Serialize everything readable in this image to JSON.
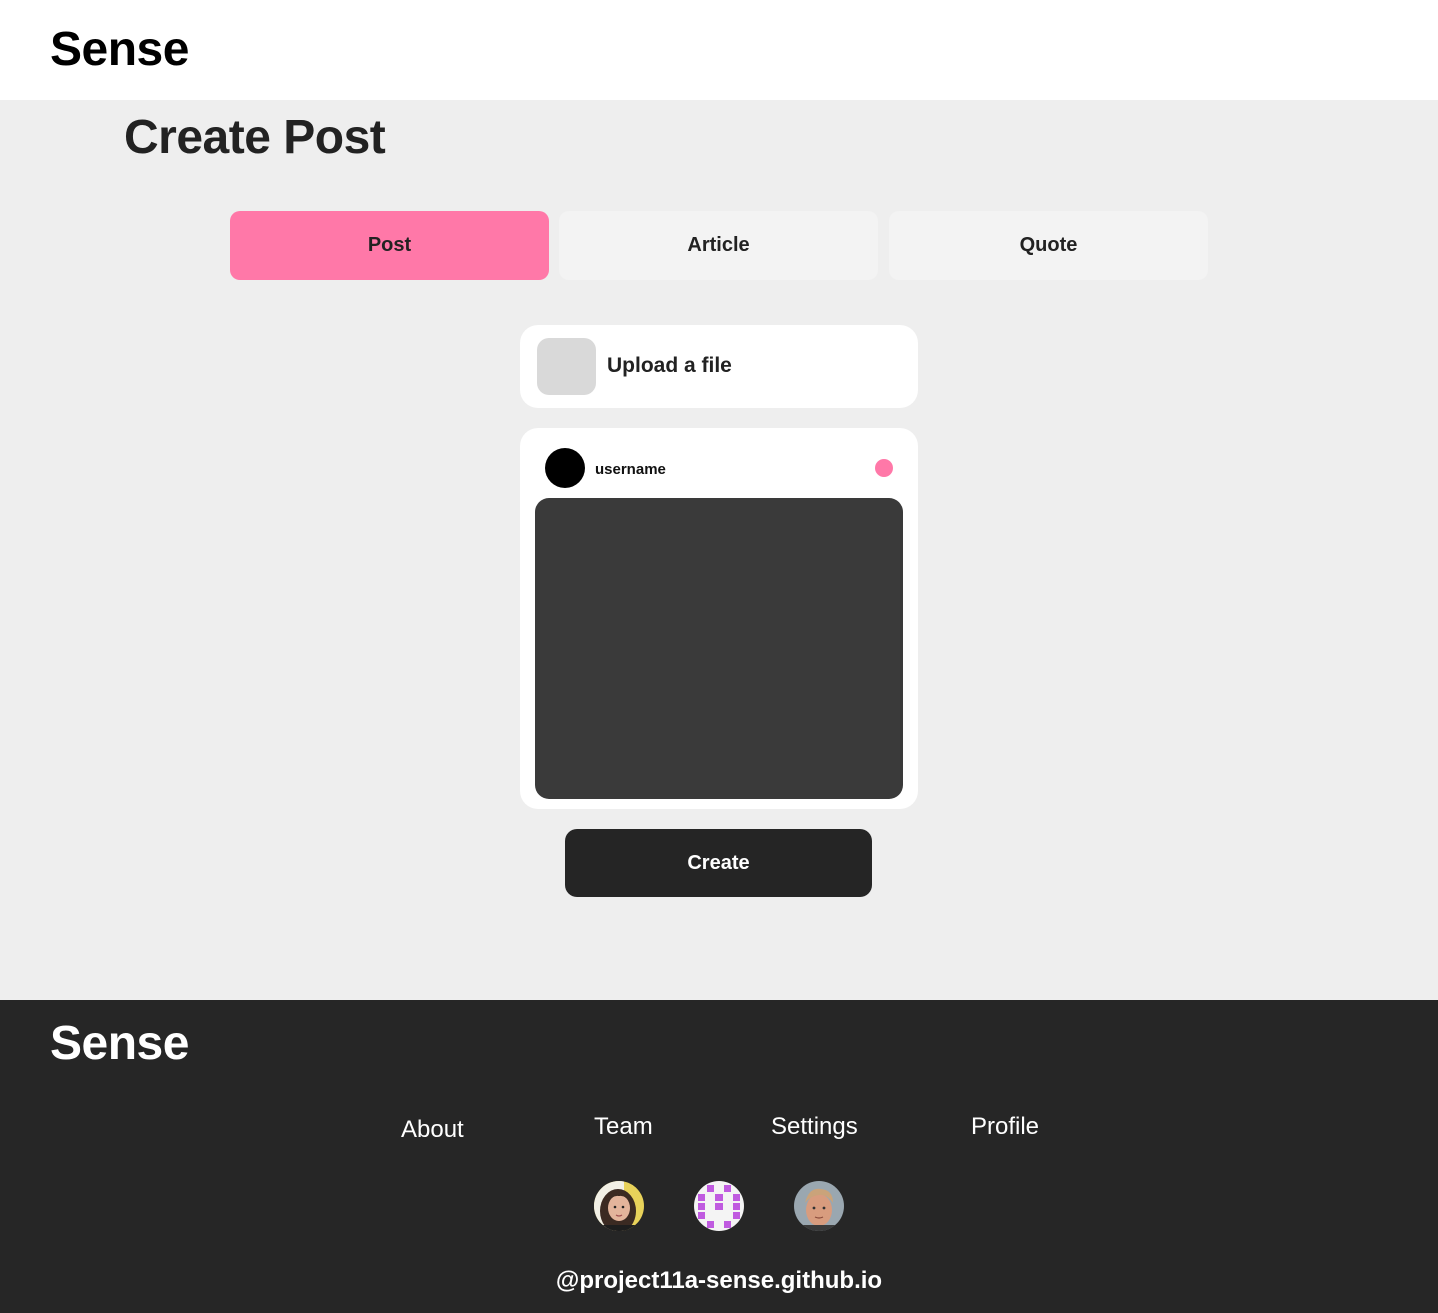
{
  "header": {
    "logo": "Sense"
  },
  "page": {
    "title": "Create Post"
  },
  "tabs": [
    {
      "label": "Post",
      "active": true
    },
    {
      "label": "Article",
      "active": false
    },
    {
      "label": "Quote",
      "active": false
    }
  ],
  "upload": {
    "label": "Upload a file"
  },
  "preview": {
    "username": "username",
    "accent_color": "#ff78a8"
  },
  "actions": {
    "create_label": "Create"
  },
  "footer": {
    "logo": "Sense",
    "links": [
      "About",
      "Team",
      "Settings",
      "Profile"
    ],
    "team_avatars": [
      "team-member-1-avatar",
      "team-member-2-avatar",
      "team-member-3-avatar"
    ],
    "handle": "@project11a-sense.github.io"
  },
  "colors": {
    "accent": "#ff78a8",
    "dark": "#262626",
    "background": "#eeeeee"
  }
}
